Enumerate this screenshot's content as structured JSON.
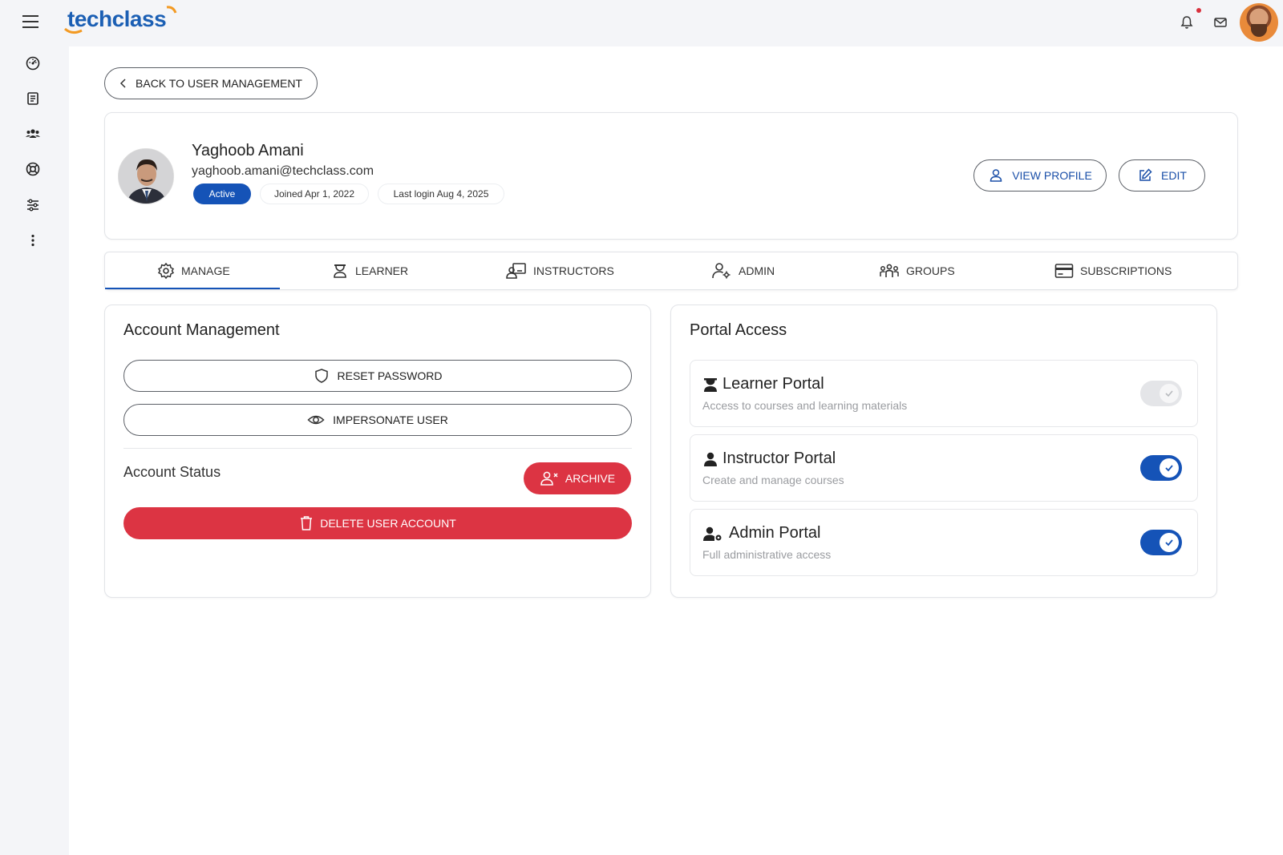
{
  "app": {
    "logo_text": "techclass",
    "colors": {
      "brand_blue": "#1b5fb4",
      "primary": "#1553b7",
      "danger": "#dc3443",
      "logo_accent": "#f39a23"
    }
  },
  "sidebar": {
    "items": [
      {
        "icon": "dashboard-icon"
      },
      {
        "icon": "courses-icon"
      },
      {
        "icon": "users-icon"
      },
      {
        "icon": "support-icon"
      },
      {
        "icon": "settings-sliders-icon"
      },
      {
        "icon": "more-vertical-icon"
      }
    ]
  },
  "header": {
    "icons": [
      "bell-icon",
      "mail-icon",
      "avatar"
    ]
  },
  "back_button": {
    "label": "BACK TO USER MANAGEMENT"
  },
  "profile": {
    "name": "Yaghoob Amani",
    "email": "yaghoob.amani@techclass.com",
    "status": "Active",
    "joined": "Joined Apr 1, 2022",
    "last_login": "Last login Aug 4, 2025",
    "view_profile_label": "VIEW PROFILE",
    "edit_label": "EDIT"
  },
  "tabs": [
    {
      "label": "MANAGE",
      "icon": "gear-icon",
      "active": true
    },
    {
      "label": "LEARNER",
      "icon": "learner-icon",
      "active": false
    },
    {
      "label": "INSTRUCTORS",
      "icon": "instructor-icon",
      "active": false
    },
    {
      "label": "ADMIN",
      "icon": "admin-icon",
      "active": false
    },
    {
      "label": "GROUPS",
      "icon": "groups-icon",
      "active": false
    },
    {
      "label": "SUBSCRIPTIONS",
      "icon": "credit-card-icon",
      "active": false
    }
  ],
  "account_management": {
    "title": "Account Management",
    "reset_password_label": "RESET PASSWORD",
    "impersonate_label": "IMPERSONATE USER",
    "status_label": "Account Status",
    "archive_label": "ARCHIVE",
    "delete_label": "DELETE USER ACCOUNT"
  },
  "portal_access": {
    "title": "Portal Access",
    "items": [
      {
        "title": "Learner Portal",
        "description": "Access to courses and learning materials",
        "enabled": true,
        "locked": true
      },
      {
        "title": "Instructor Portal",
        "description": "Create and manage courses",
        "enabled": true,
        "locked": false
      },
      {
        "title": "Admin Portal",
        "description": "Full administrative access",
        "enabled": true,
        "locked": false
      }
    ]
  }
}
